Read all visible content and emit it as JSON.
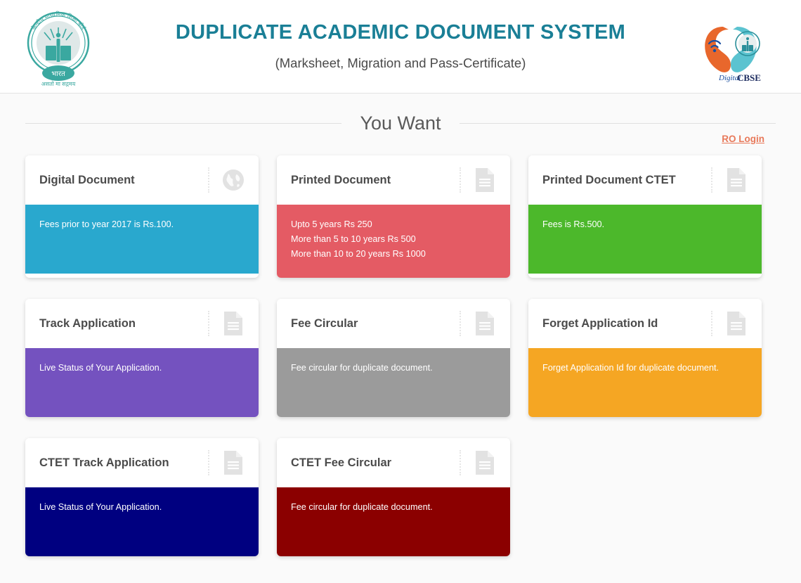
{
  "header": {
    "title": "DUPLICATE ACADEMIC DOCUMENT SYSTEM",
    "subtitle": "(Marksheet, Migration and Pass-Certificate)",
    "title_color": "#1a7f96",
    "logo_left_name": "cbse-emblem-logo",
    "logo_left_text_top": "केन्द्रीय माध्यमिक शिक्षा बोर्ड",
    "logo_left_text_mid": "भारत",
    "logo_left_text_bottom": "असतो मा सद्गमय",
    "logo_right_name": "digital-cbse-logo",
    "logo_right_text": "CBSE",
    "logo_right_script": "Digital"
  },
  "section": {
    "heading": "You Want"
  },
  "ro_login": {
    "label": "RO Login",
    "color": "#e8795a"
  },
  "cards": [
    {
      "title": "Digital Document",
      "icon": "globe-icon",
      "color": "#29a8ce",
      "lines": [
        "Fees prior to year 2017 is Rs.100."
      ]
    },
    {
      "title": "Printed Document",
      "icon": "document-icon",
      "color": "#e45b64",
      "lines": [
        "Upto 5 years Rs 250",
        "More than 5 to 10 years Rs 500",
        "More than 10 to 20 years Rs 1000"
      ]
    },
    {
      "title": "Printed Document CTET",
      "icon": "document-icon",
      "color": "#4cb82b",
      "lines": [
        "Fees is Rs.500."
      ]
    },
    {
      "title": "Track Application",
      "icon": "document-icon",
      "color": "#7452bf",
      "lines": [
        "Live Status of Your Application."
      ]
    },
    {
      "title": "Fee Circular",
      "icon": "document-icon",
      "color": "#9b9b9b",
      "lines": [
        "Fee circular for duplicate document."
      ]
    },
    {
      "title": "Forget Application Id",
      "icon": "document-icon",
      "color": "#f5a623",
      "lines": [
        "Forget Application Id for duplicate document."
      ]
    },
    {
      "title": "CTET Track Application",
      "icon": "document-icon",
      "color": "#000080",
      "lines": [
        "Live Status of Your Application."
      ]
    },
    {
      "title": "CTET Fee Circular",
      "icon": "document-icon",
      "color": "#8b0000",
      "lines": [
        "Fee circular for duplicate document."
      ]
    }
  ]
}
